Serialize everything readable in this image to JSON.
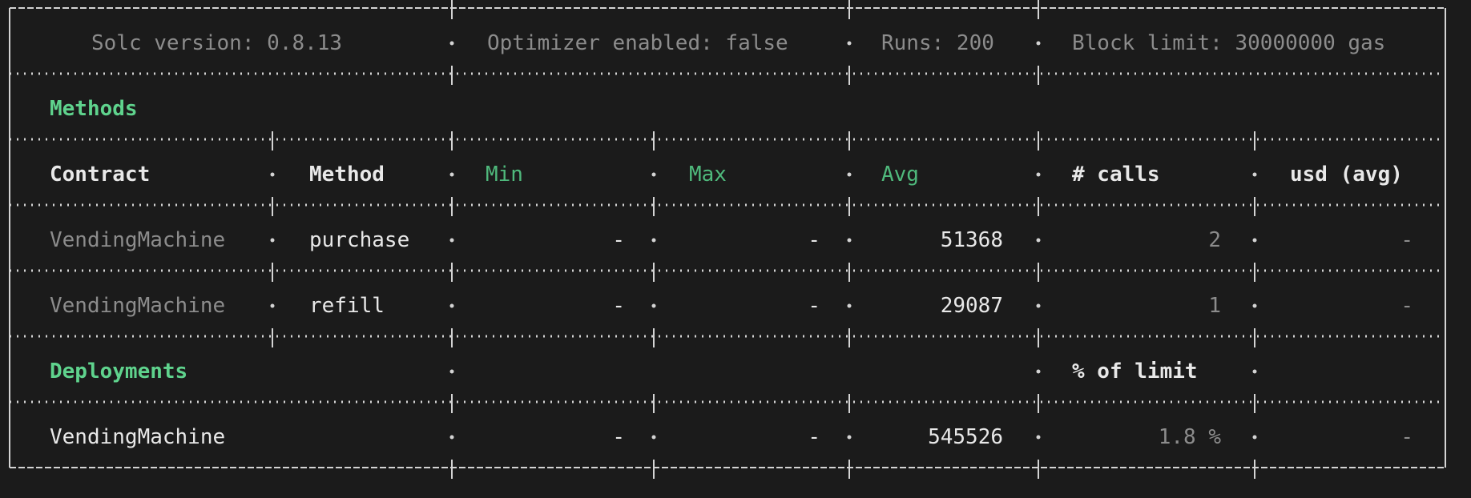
{
  "colors": {
    "background": "#1b1b1b",
    "border": "#d4d4d4",
    "bright_text": "#e8e8e8",
    "dim_text": "#8c8c8c",
    "accent_green": "#5fd38d",
    "min_max_avg_green": "#4fb97c"
  },
  "config": {
    "solc_version": "Solc version: 0.8.13",
    "optimizer": "Optimizer enabled: false",
    "runs": "Runs: 200",
    "block_limit": "Block limit: 30000000 gas"
  },
  "sections": {
    "methods": "Methods",
    "deployments": "Deployments"
  },
  "headers": {
    "contract": "Contract",
    "method": "Method",
    "min": "Min",
    "max": "Max",
    "avg": "Avg",
    "calls": "# calls",
    "usd": "usd (avg)",
    "percent_of_limit": "% of limit"
  },
  "method_rows": [
    {
      "contract": "VendingMachine",
      "method": "purchase",
      "min": "-",
      "max": "-",
      "avg": "51368",
      "calls": "2",
      "usd": "-"
    },
    {
      "contract": "VendingMachine",
      "method": "refill",
      "min": "-",
      "max": "-",
      "avg": "29087",
      "calls": "1",
      "usd": "-"
    }
  ],
  "deployments": [
    {
      "contract": "VendingMachine",
      "min": "-",
      "max": "-",
      "avg": "545526",
      "percent": "1.8 %",
      "usd": "-"
    }
  ]
}
